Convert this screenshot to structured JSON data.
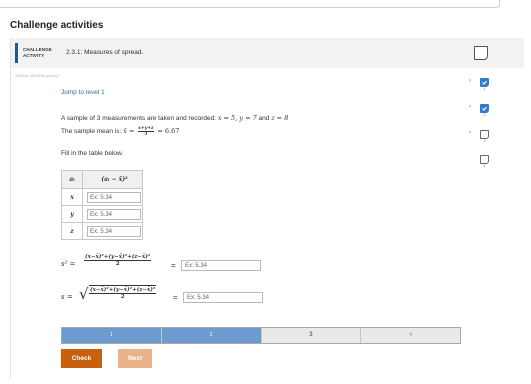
{
  "page": {
    "title": "Challenge activities"
  },
  "activity": {
    "badge_line1": "CHALLENGE",
    "badge_line2": "ACTIVITY",
    "title": "2.3.1: Measures of spread.",
    "id": "358546.3661655.qxlzqy7",
    "jump_link": "Jump to level 1"
  },
  "problem": {
    "intro": "A sample of 3 measurements are taken and recorded: ",
    "x_eq": "x = 5, y = 7",
    "and": " and ",
    "z_eq": "z = 8",
    "mean_prefix": "The sample mean is: ",
    "xbar_eq": "x̄ =",
    "mean_num": "x+y+z",
    "mean_den": "3",
    "mean_result": "= 6.67",
    "fill_instruction": "Fill in the table below."
  },
  "table": {
    "col1_header": "aᵢ",
    "col2_header": "(aᵢ − x̄)²",
    "rows": [
      {
        "var": "x",
        "placeholder": "Ex: 5.34"
      },
      {
        "var": "y",
        "placeholder": "Ex: 5.34"
      },
      {
        "var": "z",
        "placeholder": "Ex: 5.34"
      }
    ]
  },
  "variance": {
    "lhs": "s² =",
    "numerator": "(x−x̄)²+(y−x̄)²+(z−x̄)²",
    "denominator": "2",
    "equals": "=",
    "placeholder": "Ex: 5.34"
  },
  "stddev": {
    "lhs": "s =",
    "root": "√",
    "numerator": "(x−x̄)²+(y−x̄)²+(z−x̄)²",
    "denominator": "2",
    "equals": "=",
    "placeholder": "Ex: 5.34"
  },
  "progress": {
    "segments": [
      {
        "label": "1",
        "state": "done"
      },
      {
        "label": "2",
        "state": "done"
      },
      {
        "label": "3",
        "state": "current"
      },
      {
        "label": "4",
        "state": "todo"
      }
    ]
  },
  "buttons": {
    "check": "Check",
    "next": "Next"
  },
  "levels": [
    {
      "num": "1",
      "completed": true
    },
    {
      "num": "2",
      "completed": true
    },
    {
      "num": "3",
      "completed": false
    },
    {
      "num": "4",
      "completed": false
    }
  ],
  "colors": {
    "accent": "#1e5a8a",
    "link": "#2f6fa8",
    "progress_done": "#6b9bcf",
    "check_button": "#c8600e",
    "next_button": "#e8b38a",
    "level_checked": "#2f7ccf"
  },
  "icons": {
    "bookmark": "bookmark-icon",
    "checkmark": "checkmark-icon",
    "chevron": "chevron-right-icon"
  }
}
